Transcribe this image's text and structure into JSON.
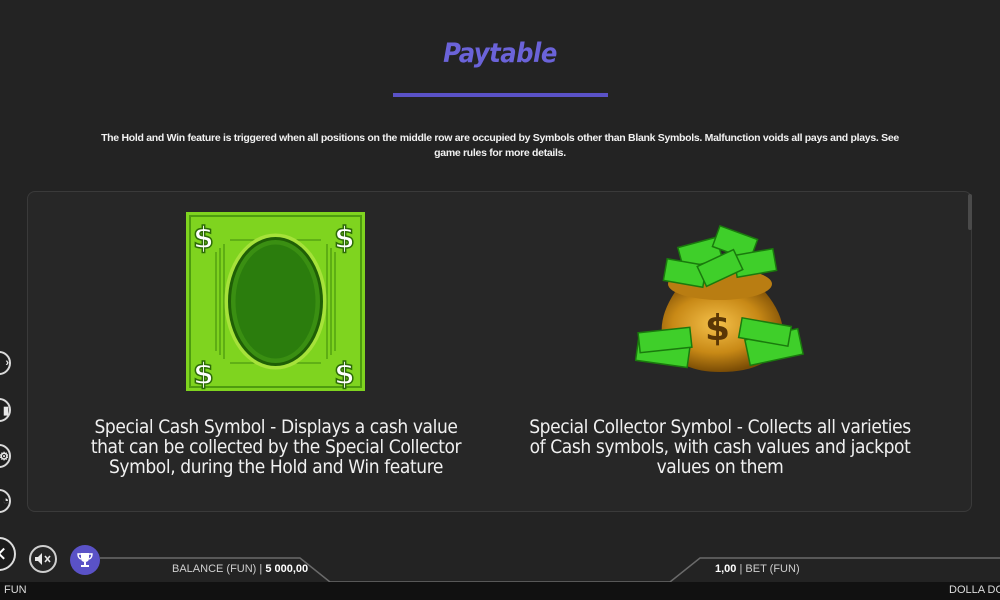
{
  "header": {
    "title": "Paytable",
    "intro": "The Hold and Win feature is triggered when all positions on the middle row are occupied by Symbols other than Blank Symbols. Malfunction voids all pays and plays. See game rules for more details."
  },
  "symbols": [
    {
      "icon": "cash-bill-icon",
      "description": "Special Cash Symbol - Displays a cash value that can be collected by the Special Collector Symbol, during the Hold and Win feature"
    },
    {
      "icon": "money-bag-icon",
      "description": "Special Collector Symbol - Collects all varieties of Cash symbols, with cash values and jackpot values on them"
    }
  ],
  "bottom_bar": {
    "balance_label": "BALANCE (FUN)",
    "balance_value": "5 000,00",
    "bet_value": "1,00",
    "bet_label": "BET",
    "bet_currency": "(FUN)",
    "currency_left": "FUN",
    "game_name": "DOLLA DOLL"
  },
  "colors": {
    "background": "#232323",
    "accent": "#5a52c7",
    "bill_green": "#7ed321"
  }
}
